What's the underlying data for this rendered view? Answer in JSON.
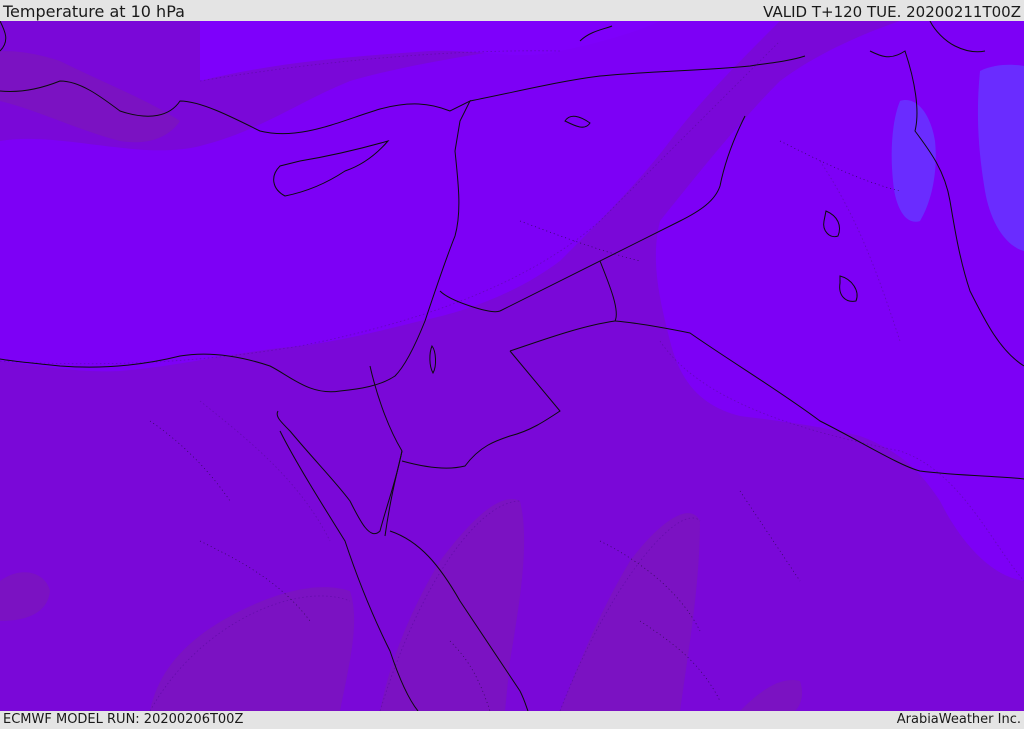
{
  "header": {
    "title": "Temperature at 10 hPa",
    "valid": "VALID T+120 TUE. 20200211T00Z"
  },
  "footer": {
    "model_run": "ECMWF MODEL RUN: 20200206T00Z",
    "credit": "ArabiaWeather Inc."
  },
  "colors": {
    "bar_background": "#e4e4e4",
    "band_dark": "#7a10cc",
    "band_mid": "#7d00f0",
    "band_light": "#7f00ff",
    "band_coldest": "#6a2cff",
    "band_warm": "#7f12b8",
    "coastline": "#0c0c0c"
  }
}
